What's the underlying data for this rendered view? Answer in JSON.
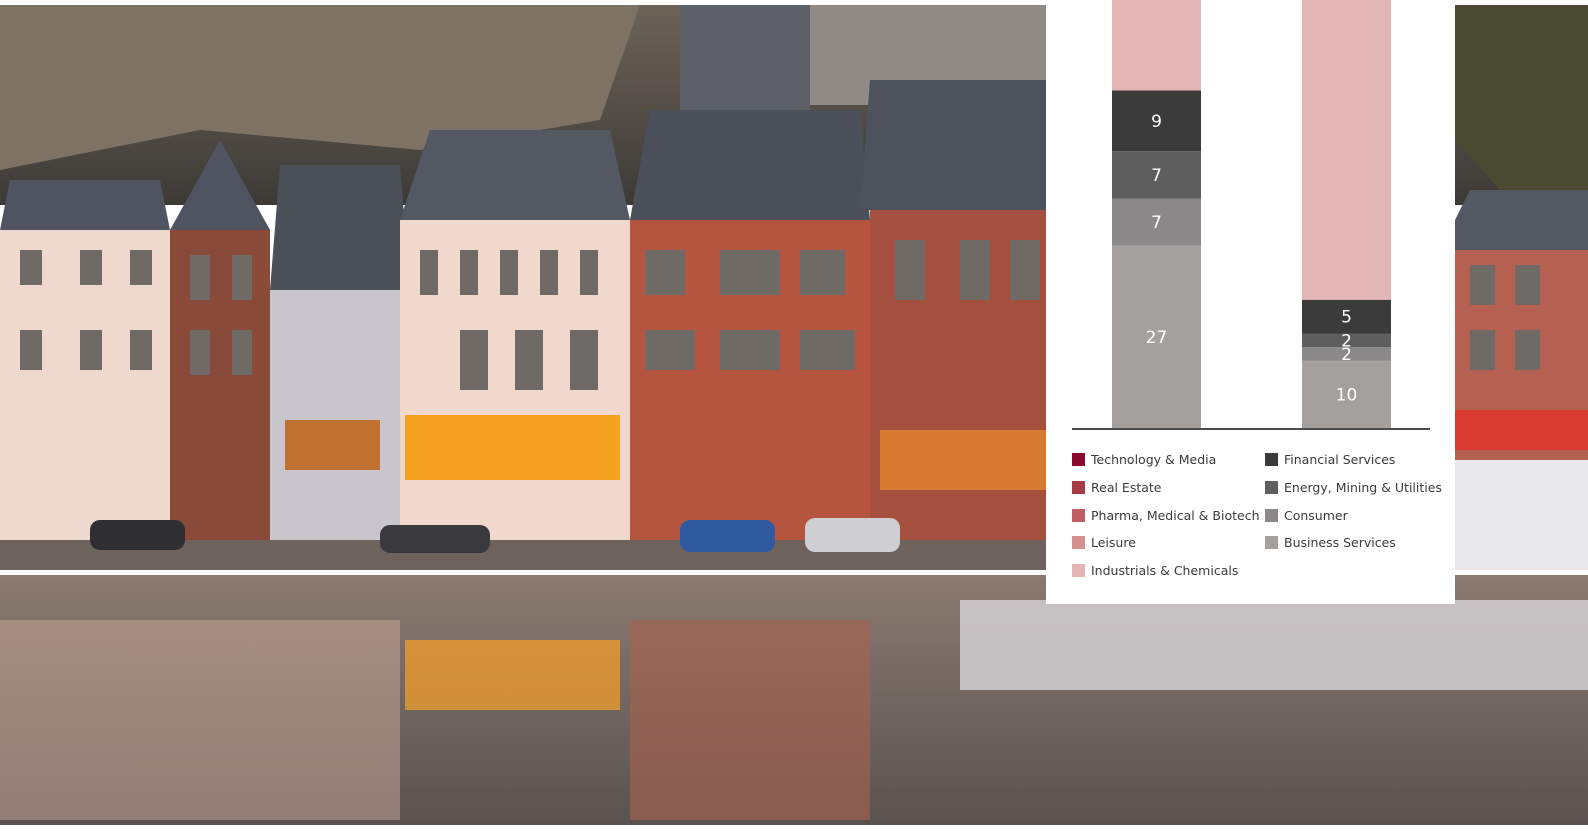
{
  "background": {
    "subject": "photo",
    "alt": ""
  },
  "chart_data": {
    "type": "bar",
    "stacked": true,
    "categories": [
      "",
      ""
    ],
    "series": [
      {
        "name": "Business Services",
        "color": "#a3a09e",
        "values": [
          27,
          10
        ]
      },
      {
        "name": "Consumer",
        "color": "#8a8888",
        "values": [
          7,
          2
        ]
      },
      {
        "name": "Energy, Mining & Utilities",
        "color": "#5e5e5e",
        "values": [
          7,
          2
        ]
      },
      {
        "name": "Financial Services",
        "color": "#3b3b3b",
        "values": [
          9,
          5
        ]
      },
      {
        "name": "Industrials & Chemicals",
        "color": "#e3b5b4",
        "values": [
          null,
          null
        ]
      },
      {
        "name": "Leisure",
        "color": "#d68f8e",
        "values": [
          null,
          null
        ]
      },
      {
        "name": "Pharma, Medical & Biotech",
        "color": "#bf5f62",
        "values": [
          null,
          null
        ]
      },
      {
        "name": "Real Estate",
        "color": "#a63a45",
        "values": [
          null,
          null
        ]
      },
      {
        "name": "Technology & Media",
        "color": "#8c0a2e",
        "values": [
          null,
          null
        ]
      }
    ],
    "legend": {
      "placement": "bottom",
      "left": [
        "Technology & Media",
        "Real Estate",
        "Pharma, Medical & Biotech",
        "Leisure",
        "Industrials & Chemicals"
      ],
      "right": [
        "Financial Services",
        "Energy, Mining & Utilities",
        "Consumer",
        "Business Services"
      ]
    },
    "grid": false,
    "title": "",
    "xlabel": "",
    "ylabel": ""
  }
}
